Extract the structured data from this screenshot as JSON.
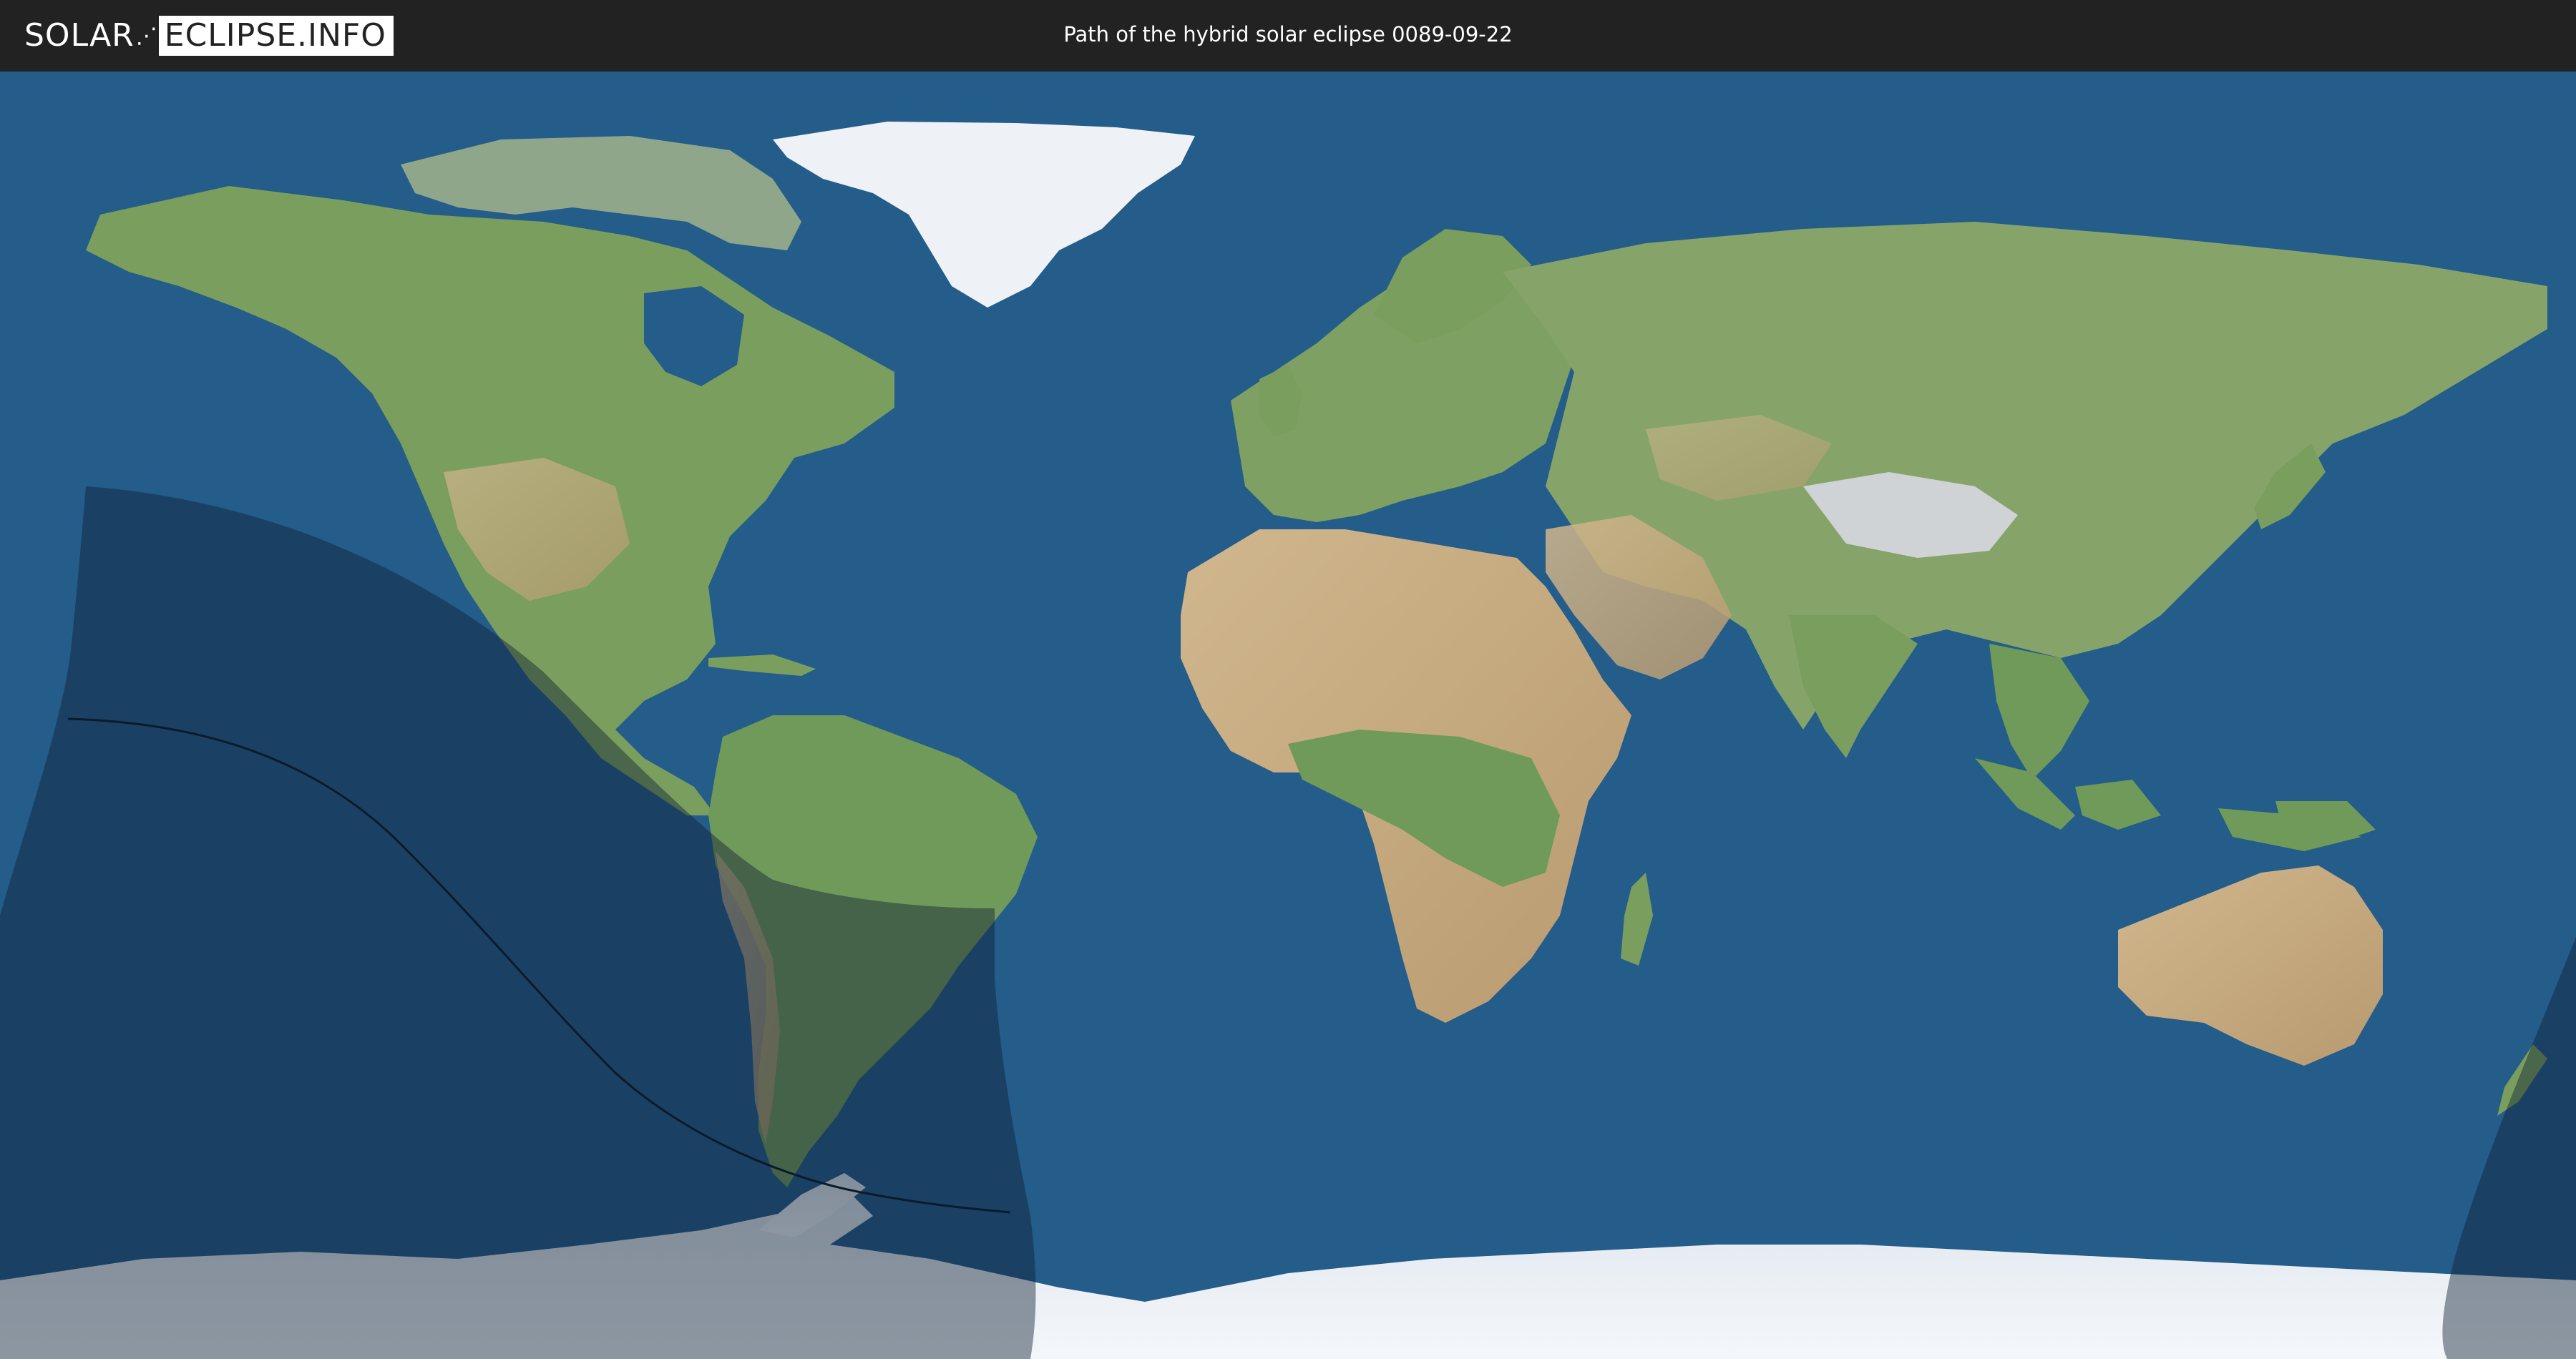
{
  "header": {
    "logo_part1": "SOLAR",
    "logo_separator": "⋰",
    "logo_part2": "ECLIPSE.INFO",
    "title": "Path of the hybrid solar eclipse 0089-09-22"
  },
  "map": {
    "projection": "equirectangular",
    "colors": {
      "ocean": "#245c8a",
      "land_green": "#6f9a5a",
      "land_desert": "#c9ae83",
      "ice": "#e8edf2",
      "eclipse_shadow": "#0f2236",
      "central_line": "#0c1a2a"
    },
    "eclipse": {
      "type": "hybrid",
      "date": "0089-09-22"
    }
  }
}
